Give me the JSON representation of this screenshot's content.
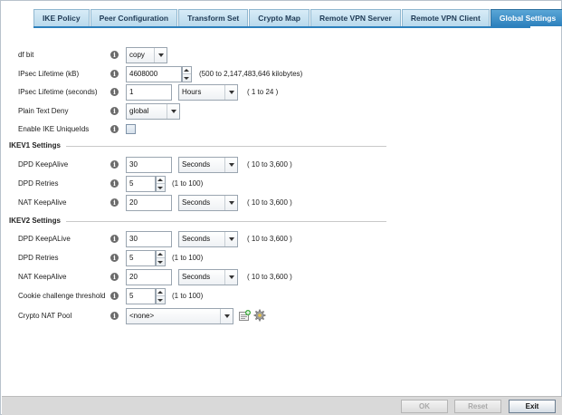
{
  "tabs": [
    {
      "label": "IKE Policy"
    },
    {
      "label": "Peer Configuration"
    },
    {
      "label": "Transform Set"
    },
    {
      "label": "Crypto Map"
    },
    {
      "label": "Remote VPN Server"
    },
    {
      "label": "Remote VPN Client"
    },
    {
      "label": "Global Settings",
      "active": true
    }
  ],
  "general": {
    "df_bit": {
      "label": "df bit",
      "value": "copy"
    },
    "ipsec_lifetime_kb": {
      "label": "IPsec Lifetime (kB)",
      "value": "4608000",
      "hint": "(500 to 2,147,483,646 kilobytes)"
    },
    "ipsec_lifetime_sec": {
      "label": "IPsec Lifetime (seconds)",
      "value": "1",
      "unit": "Hours",
      "hint": "( 1 to 24 )"
    },
    "plain_text_deny": {
      "label": "Plain Text Deny",
      "value": "global"
    },
    "enable_ike_uniqueids": {
      "label": "Enable IKE UniqueIds",
      "checked": false
    }
  },
  "ikev1": {
    "title": "IKEV1 Settings",
    "dpd_keepalive": {
      "label": "DPD KeepAlive",
      "value": "30",
      "unit": "Seconds",
      "hint": "( 10 to 3,600 )"
    },
    "dpd_retries": {
      "label": "DPD Retries",
      "value": "5",
      "hint": "(1 to 100)"
    },
    "nat_keepalive": {
      "label": "NAT KeepAlive",
      "value": "20",
      "unit": "Seconds",
      "hint": "( 10 to 3,600 )"
    }
  },
  "ikev2": {
    "title": "IKEV2 Settings",
    "dpd_keepalive": {
      "label": "DPD KeepALive",
      "value": "30",
      "unit": "Seconds",
      "hint": "( 10 to 3,600 )"
    },
    "dpd_retries": {
      "label": "DPD Retries",
      "value": "5",
      "hint": "(1 to 100)"
    },
    "nat_keepalive": {
      "label": "NAT KeepAlive",
      "value": "20",
      "unit": "Seconds",
      "hint": "( 10 to 3,600 )"
    },
    "cookie_threshold": {
      "label": "Cookie challenge threshold",
      "value": "5",
      "hint": "(1 to 100)"
    },
    "crypto_nat_pool": {
      "label": "Crypto NAT Pool",
      "value": "<none>"
    }
  },
  "info_glyph": "i",
  "buttons": {
    "ok": "OK",
    "reset": "Reset",
    "exit": "Exit"
  },
  "colors": {
    "active_tab": "#2c80bd",
    "tab_bg": "#c6e2f2"
  }
}
